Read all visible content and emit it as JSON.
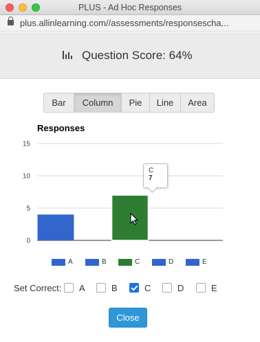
{
  "window": {
    "title": "PLUS - Ad Hoc Responses"
  },
  "browser": {
    "url": "plus.allinlearning.com//assessments/responsescha..."
  },
  "header": {
    "title": "Question Score: 64%"
  },
  "chart_types": [
    {
      "label": "Bar",
      "active": false
    },
    {
      "label": "Column",
      "active": true
    },
    {
      "label": "Pie",
      "active": false
    },
    {
      "label": "Line",
      "active": false
    },
    {
      "label": "Area",
      "active": false
    }
  ],
  "chart_data": {
    "type": "bar",
    "title": "Responses",
    "categories": [
      "A",
      "B",
      "C",
      "D",
      "E"
    ],
    "values": [
      4,
      0,
      7,
      0,
      0
    ],
    "colors": [
      "#3366cc",
      "#3366cc",
      "#2e7d32",
      "#3366cc",
      "#3366cc"
    ],
    "ylim": [
      0,
      15
    ],
    "yticks": [
      0,
      5,
      10,
      15
    ],
    "grid": true,
    "legend": "bottom",
    "tooltip": {
      "category": "C",
      "value": "7"
    }
  },
  "legend_colors": {
    "default": "#3366cc",
    "correct": "#2e7d32"
  },
  "set_correct": {
    "label": "Set Correct:",
    "options": [
      {
        "label": "A",
        "checked": false
      },
      {
        "label": "B",
        "checked": false
      },
      {
        "label": "C",
        "checked": true
      },
      {
        "label": "D",
        "checked": false
      },
      {
        "label": "E",
        "checked": false
      }
    ]
  },
  "close_label": "Close"
}
